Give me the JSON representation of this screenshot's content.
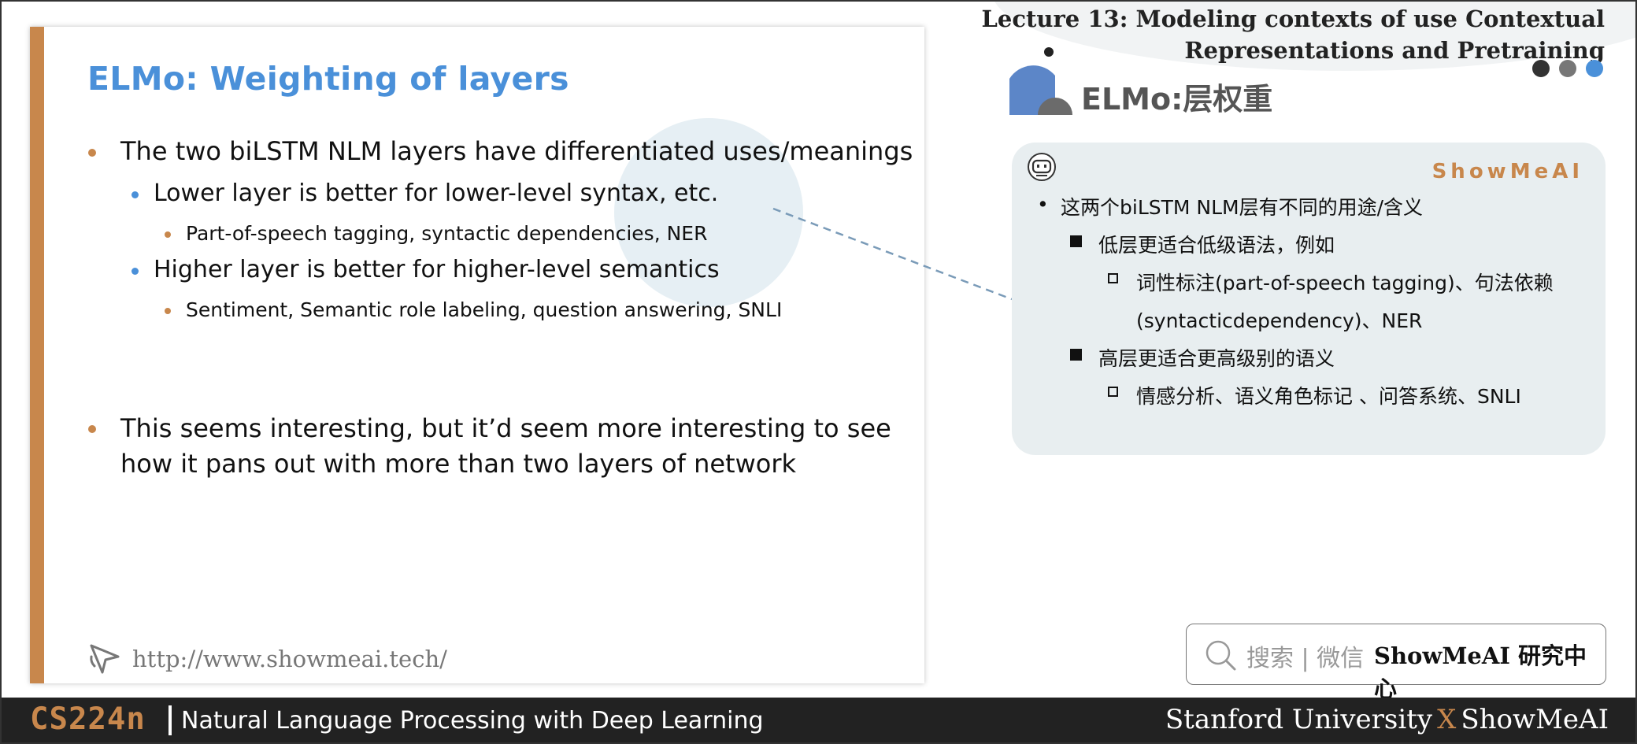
{
  "slide": {
    "title": "ELMo: Weighting of layers",
    "bullets": {
      "b1": "The two biLSTM NLM layers have differentiated uses/meanings",
      "b1_1": "Lower layer is better for lower-level syntax, etc.",
      "b1_1_1": "Part-of-speech tagging, syntactic dependencies, NER",
      "b1_2": "Higher layer is better for higher-level semantics",
      "b1_2_1": "Sentiment, Semantic role labeling, question answering, SNLI",
      "b2_line1": "This seems interesting, but it’d seem more interesting to see",
      "b2_line2": "how it pans out with more than two layers of network"
    },
    "url": "http://www.showmeai.tech/"
  },
  "header": {
    "lecture_line1": "Lecture 13:  Modeling contexts of use Contextual",
    "lecture_line2": "Representations and Pretraining",
    "zh_title": "ELMo:层权重",
    "dot_colors": [
      "#333333",
      "#777777",
      "#4a90d9"
    ]
  },
  "notes": {
    "brand": "ShowMeAI",
    "items": {
      "n1": "这两个biLSTM NLM层有不同的用途/含义",
      "n1_1": "低层更适合低级语法，例如",
      "n1_1_1_a": "词性标注(part-of-speech  tagging)、句法依赖",
      "n1_1_1_b": "(syntacticdependency)、NER",
      "n1_2": "高层更适合更高级别的语义",
      "n1_2_1": "情感分析、语义角色标记 、问答系统、SNLI"
    }
  },
  "search": {
    "hint": "搜索 | 微信",
    "brand": "ShowMeAI 研究中心"
  },
  "footer": {
    "course_code": "CS224n",
    "course_name": "Natural Language Processing with Deep Learning",
    "credit_left": "Stanford University",
    "credit_x": "X",
    "credit_right": "ShowMeAI"
  },
  "colors": {
    "accent": "#c8874c",
    "title_blue": "#4a90d9",
    "bar": "#222222",
    "card": "#e8eef0"
  }
}
